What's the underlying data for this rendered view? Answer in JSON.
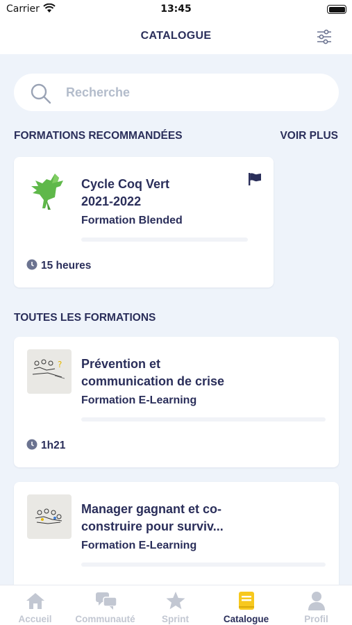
{
  "status_bar": {
    "carrier": "Carrier",
    "time": "13:45"
  },
  "header": {
    "title": "CATALOGUE",
    "filter_icon": "sliders-icon"
  },
  "search": {
    "placeholder": "Recherche",
    "icon": "search-icon"
  },
  "recommended": {
    "heading": "FORMATIONS RECOMMANDÉES",
    "see_more": "VOIR PLUS",
    "card": {
      "title_line1": "Cycle Coq Vert",
      "title_line2": "2021-2022",
      "type": "Formation Blended",
      "duration": "15 heures",
      "progress": 0,
      "thumbnail": "green-rooster-logo",
      "flag_icon": "flag-icon",
      "flag_color": "#2a2e5a",
      "logo_color": "#5fb84a"
    }
  },
  "all": {
    "heading": "TOUTES LES FORMATIONS",
    "courses": [
      {
        "title_line1": "Prévention et",
        "title_line2": "communication de crise",
        "type": "Formation E-Learning",
        "duration": "1h21",
        "progress": 0,
        "thumbnail": "sketch-illustration"
      },
      {
        "title_line1": "Manager gagnant et co-",
        "title_line2": "construire pour surviv...",
        "type": "Formation E-Learning",
        "progress": 0,
        "thumbnail": "sketch-illustration"
      }
    ]
  },
  "tabbar": {
    "active_color": "#2a2e5a",
    "inactive_color": "#c2c7d2",
    "active_icon_color": "#f7c81e",
    "items": [
      {
        "label": "Accueil",
        "icon": "home-icon",
        "active": false
      },
      {
        "label": "Communauté",
        "icon": "chat-icon",
        "active": false
      },
      {
        "label": "Sprint",
        "icon": "star-icon",
        "active": false
      },
      {
        "label": "Catalogue",
        "icon": "book-icon",
        "active": true
      },
      {
        "label": "Profil",
        "icon": "user-icon",
        "active": false
      }
    ]
  }
}
